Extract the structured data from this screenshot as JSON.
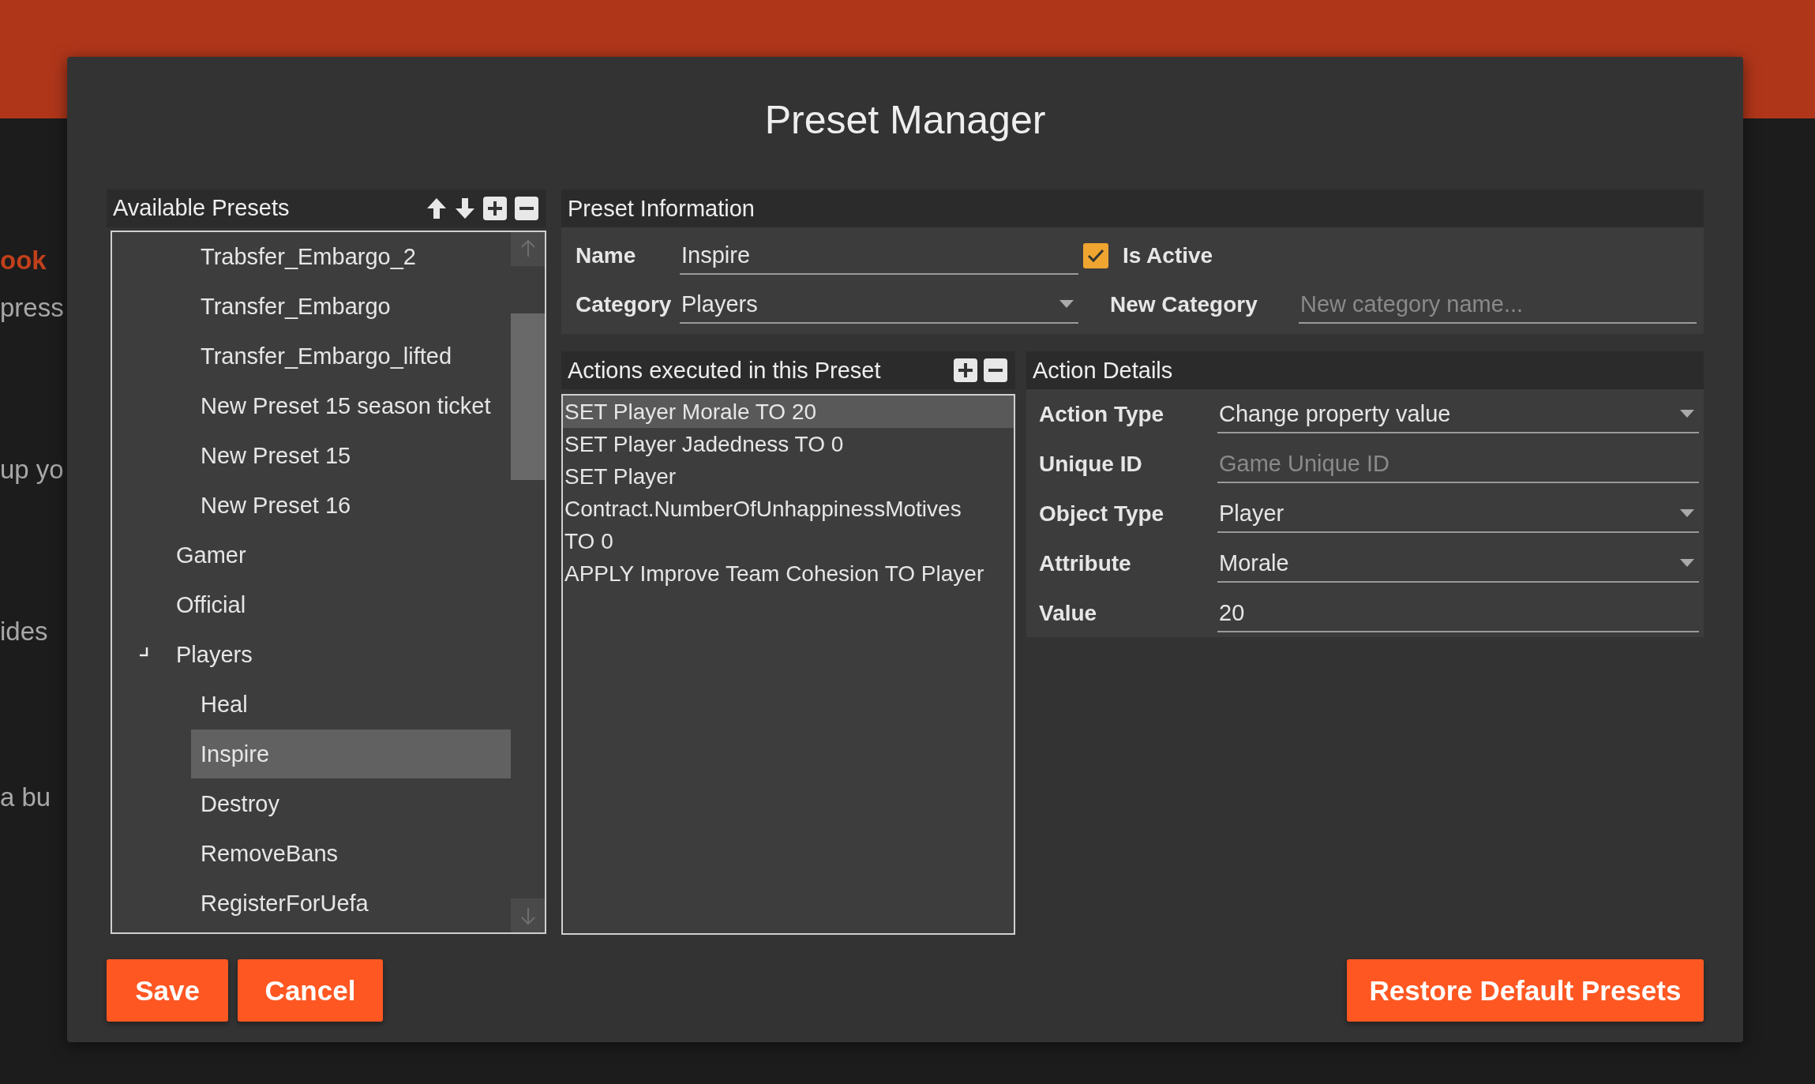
{
  "background": {
    "texts": [
      {
        "kind": "heading",
        "text": "ook"
      },
      {
        "kind": "text",
        "text": "press"
      },
      {
        "kind": "text",
        "text": "up yo"
      },
      {
        "kind": "text",
        "text": "ides"
      },
      {
        "kind": "text",
        "text": "a bu"
      }
    ]
  },
  "dialog": {
    "title": "Preset Manager"
  },
  "available_presets": {
    "title": "Available Presets",
    "tree": {
      "partial_children": [
        {
          "label": "Trabsfer_Embargo_2",
          "selected": false
        },
        {
          "label": "Transfer_Embargo",
          "selected": false
        },
        {
          "label": "Transfer_Embargo_lifted",
          "selected": false
        },
        {
          "label": "New Preset 15 season ticket",
          "selected": false
        },
        {
          "label": "New Preset 15",
          "selected": false
        },
        {
          "label": "New Preset 16",
          "selected": false
        }
      ],
      "categories": [
        {
          "label": "Gamer",
          "selected": false
        },
        {
          "label": "Official",
          "selected": false
        },
        {
          "label": "Players",
          "selected": false,
          "expanded": true,
          "children": [
            {
              "label": "Heal",
              "selected": false
            },
            {
              "label": "Inspire",
              "selected": true
            },
            {
              "label": "Destroy",
              "selected": false
            },
            {
              "label": "RemoveBans",
              "selected": false
            },
            {
              "label": "RegisterForUefa",
              "selected": false
            }
          ]
        }
      ]
    }
  },
  "preset_information": {
    "title": "Preset Information",
    "name_label": "Name",
    "name_value": "Inspire",
    "is_active": {
      "label": "Is Active",
      "checked": true
    },
    "category_label": "Category",
    "category_value": "Players",
    "new_category_label": "New Category",
    "new_category_placeholder": "New category name..."
  },
  "actions": {
    "title": "Actions executed in this Preset",
    "items": [
      {
        "text": "SET Player Morale TO 20",
        "selected": true
      },
      {
        "text": "SET Player Jadedness TO 0",
        "selected": false
      },
      {
        "text": "SET Player Contract.NumberOfUnhappinessMotives TO 0",
        "selected": false
      },
      {
        "text": "APPLY Improve Team Cohesion TO Player",
        "selected": false
      }
    ]
  },
  "action_details": {
    "title": "Action Details",
    "rows": [
      {
        "label": "Action Type",
        "kind": "dropdown",
        "value": "Change property value"
      },
      {
        "label": "Unique ID",
        "kind": "text",
        "placeholder": "Game Unique ID"
      },
      {
        "label": "Object Type",
        "kind": "dropdown",
        "value": "Player"
      },
      {
        "label": "Attribute",
        "kind": "dropdown",
        "value": "Morale"
      },
      {
        "label": "Value",
        "kind": "text",
        "value": "20"
      }
    ]
  },
  "buttons": {
    "save": "Save",
    "cancel": "Cancel",
    "restore": "Restore Default Presets"
  }
}
